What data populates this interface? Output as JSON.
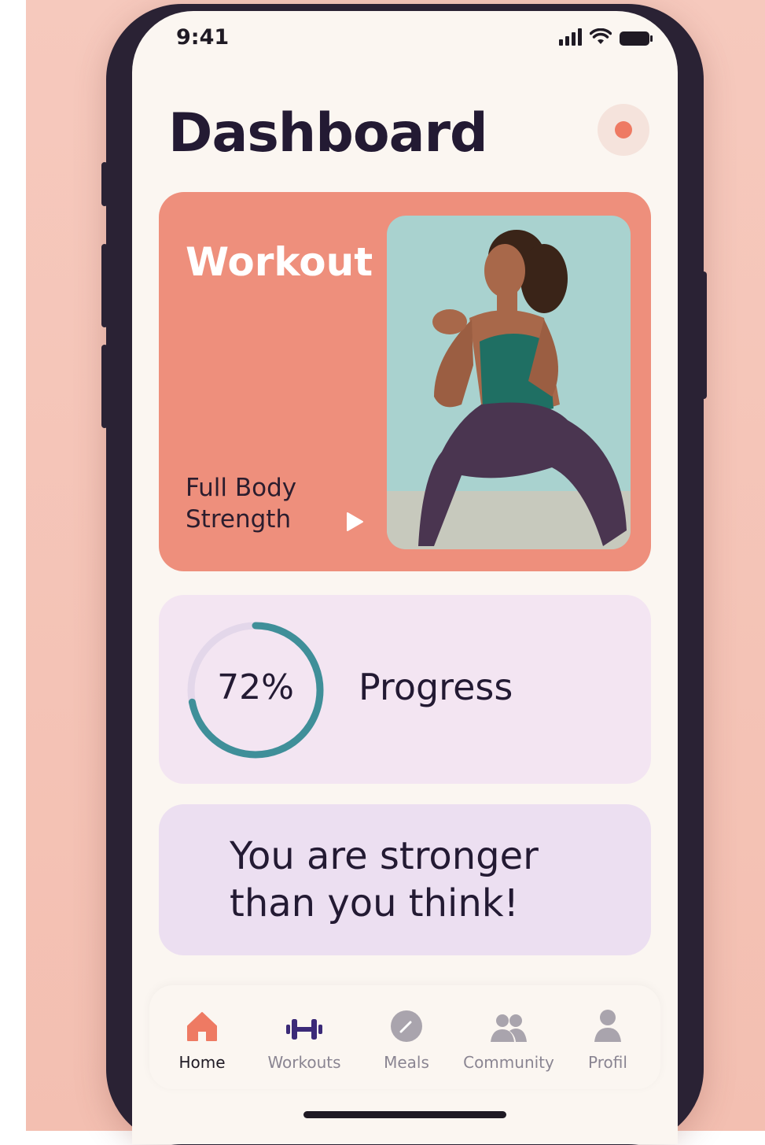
{
  "status_bar": {
    "time": "9:41"
  },
  "header": {
    "title": "Dashboard"
  },
  "workout_card": {
    "title": "Workout",
    "subtitle": "Full Body Strength"
  },
  "progress_card": {
    "percent_label": "72%",
    "progress_value": 0.72,
    "label": "Progress"
  },
  "quote_card": {
    "text": "You are stronger than you think!"
  },
  "tabbar": {
    "items": [
      {
        "label": "Home",
        "icon": "home-icon",
        "active": true
      },
      {
        "label": "Workouts",
        "icon": "dumbbell-icon",
        "active": false
      },
      {
        "label": "Meals",
        "icon": "compass-icon",
        "active": false
      },
      {
        "label": "Community",
        "icon": "people-icon",
        "active": false
      },
      {
        "label": "Profil",
        "icon": "person-icon",
        "active": false
      }
    ]
  },
  "colors": {
    "accent": "#ee7a63",
    "workout_card": "#ee8f7c",
    "progress_card": "#f3e5f2",
    "quote_card": "#ecdff1",
    "ring": "#3f8f99",
    "ring_track": "#e3d7ea",
    "tab_dumbbell": "#3b2a78"
  }
}
